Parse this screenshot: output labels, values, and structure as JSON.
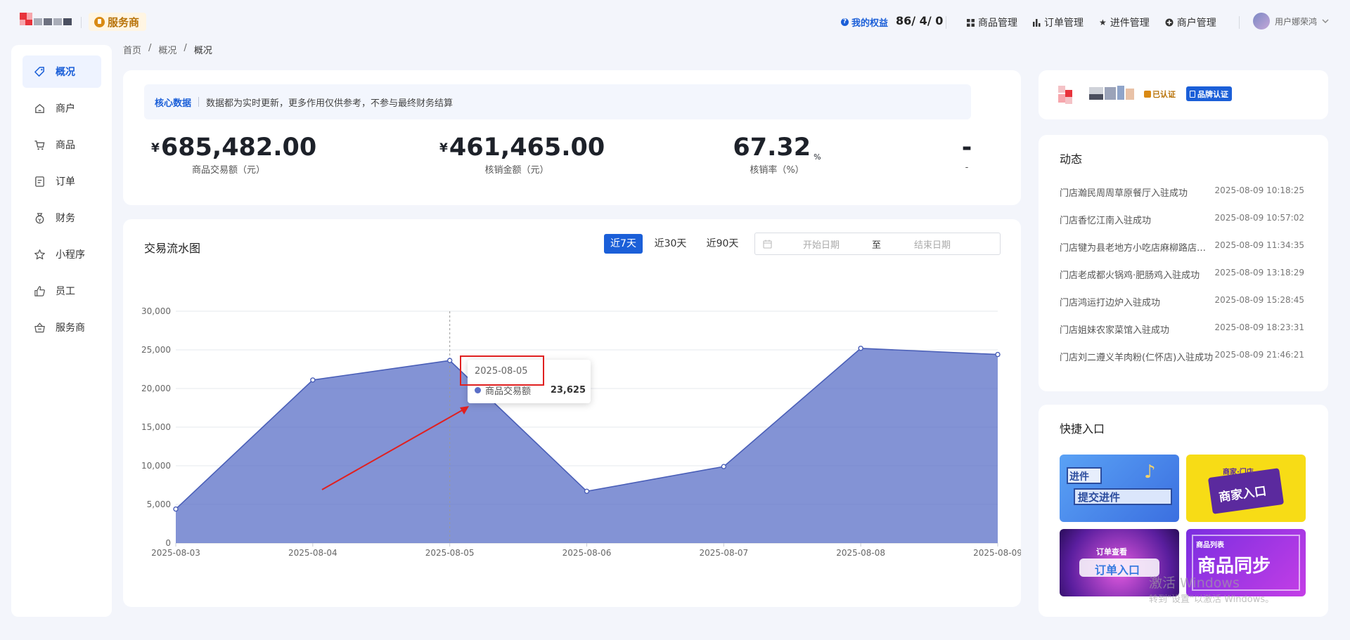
{
  "header": {
    "provider_badge": "服务商",
    "rights_label": "我的权益",
    "counts": "86/ 4/ 0",
    "nav": [
      "商品管理",
      "订单管理",
      "进件管理",
      "商户管理"
    ],
    "user_name": "用户娜荣鸿"
  },
  "sidebar": {
    "items": [
      "概况",
      "商户",
      "商品",
      "订单",
      "财务",
      "小程序",
      "员工",
      "服务商"
    ],
    "active_index": 0
  },
  "breadcrumb": [
    "首页",
    "概况",
    "概况"
  ],
  "core": {
    "label": "核心数据",
    "note": "数据都为实时更新，更多作用仅供参考，不参与最终财务结算",
    "currency": "¥",
    "metrics": [
      {
        "value": "685,482.00",
        "label": "商品交易额（元）"
      },
      {
        "value": "461,465.00",
        "label": "核销金额（元）"
      },
      {
        "value": "67.32",
        "unit": "%",
        "label": "核销率（%）"
      },
      {
        "value": "-",
        "label": "-"
      }
    ]
  },
  "chart_panel": {
    "title": "交易流水图",
    "ranges": [
      "近7天",
      "近30天",
      "近90天"
    ],
    "active_range": 0,
    "date_start_placeholder": "开始日期",
    "date_sep": "至",
    "date_end_placeholder": "结束日期",
    "tooltip": {
      "date": "2025-08-05",
      "series": "商品交易额",
      "value": "23,625"
    }
  },
  "chart_data": {
    "type": "area",
    "x": [
      "2025-08-03",
      "2025-08-04",
      "2025-08-05",
      "2025-08-06",
      "2025-08-07",
      "2025-08-08",
      "2025-08-09"
    ],
    "series": [
      {
        "name": "商品交易额",
        "values": [
          4400,
          21100,
          23625,
          6700,
          9900,
          25200,
          24400
        ]
      }
    ],
    "yticks": [
      "0",
      "5,000",
      "10,000",
      "15,000",
      "20,000",
      "25,000",
      "30,000"
    ],
    "ylim": [
      0,
      30000
    ],
    "grid": true,
    "color": "#5a6fc7"
  },
  "company": {
    "verified": "已认证",
    "brand": "品牌认证"
  },
  "feed": {
    "title": "动态",
    "items": [
      {
        "text": "门店瀚民周周草原餐厅入驻成功",
        "time": "2025-08-09 10:18:25"
      },
      {
        "text": "门店香忆江南入驻成功",
        "time": "2025-08-09 10:57:02"
      },
      {
        "text": "门店犍为县老地方小吃店麻柳路店入驻成功",
        "time": "2025-08-09 11:34:35"
      },
      {
        "text": "门店老成都火锅鸡·肥肠鸡入驻成功",
        "time": "2025-08-09 13:18:29"
      },
      {
        "text": "门店鸿运打边炉入驻成功",
        "time": "2025-08-09 15:28:45"
      },
      {
        "text": "门店姐妹农家菜馆入驻成功",
        "time": "2025-08-09 18:23:31"
      },
      {
        "text": "门店刘二遵义羊肉粉(仁怀店)入驻成功",
        "time": "2025-08-09 21:46:21"
      }
    ]
  },
  "quick": {
    "title": "快捷入口",
    "tiles": [
      {
        "top": "进件",
        "main": "提交进件"
      },
      {
        "top": "商家·门店",
        "main": "商家入口"
      },
      {
        "top": "订单查看",
        "main": "订单入口"
      },
      {
        "top": "商品列表",
        "main": "商品同步"
      }
    ]
  },
  "watermark": {
    "line1": "激活 Windows",
    "line2": "转到\"设置\"以激活 Windows。"
  }
}
